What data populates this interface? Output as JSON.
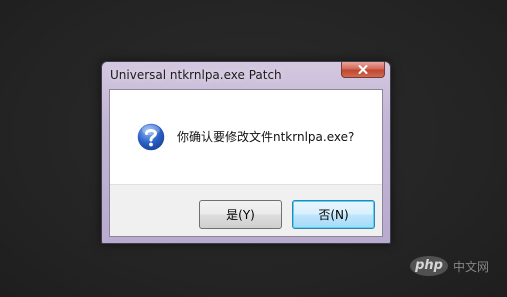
{
  "window": {
    "title": "Universal ntkrnlpa.exe Patch",
    "message": "你确认要修改文件ntkrnlpa.exe?",
    "buttons": {
      "yes_label": "是(Y)",
      "no_label": "否(N)"
    },
    "icons": {
      "dialog": "question-icon",
      "close": "close-icon"
    },
    "colors": {
      "close_button": "#c04632",
      "question_icon": "#2a60c8",
      "default_button_border": "#3c7fb1"
    }
  },
  "watermark": {
    "logo": "php",
    "text": "中文网"
  }
}
